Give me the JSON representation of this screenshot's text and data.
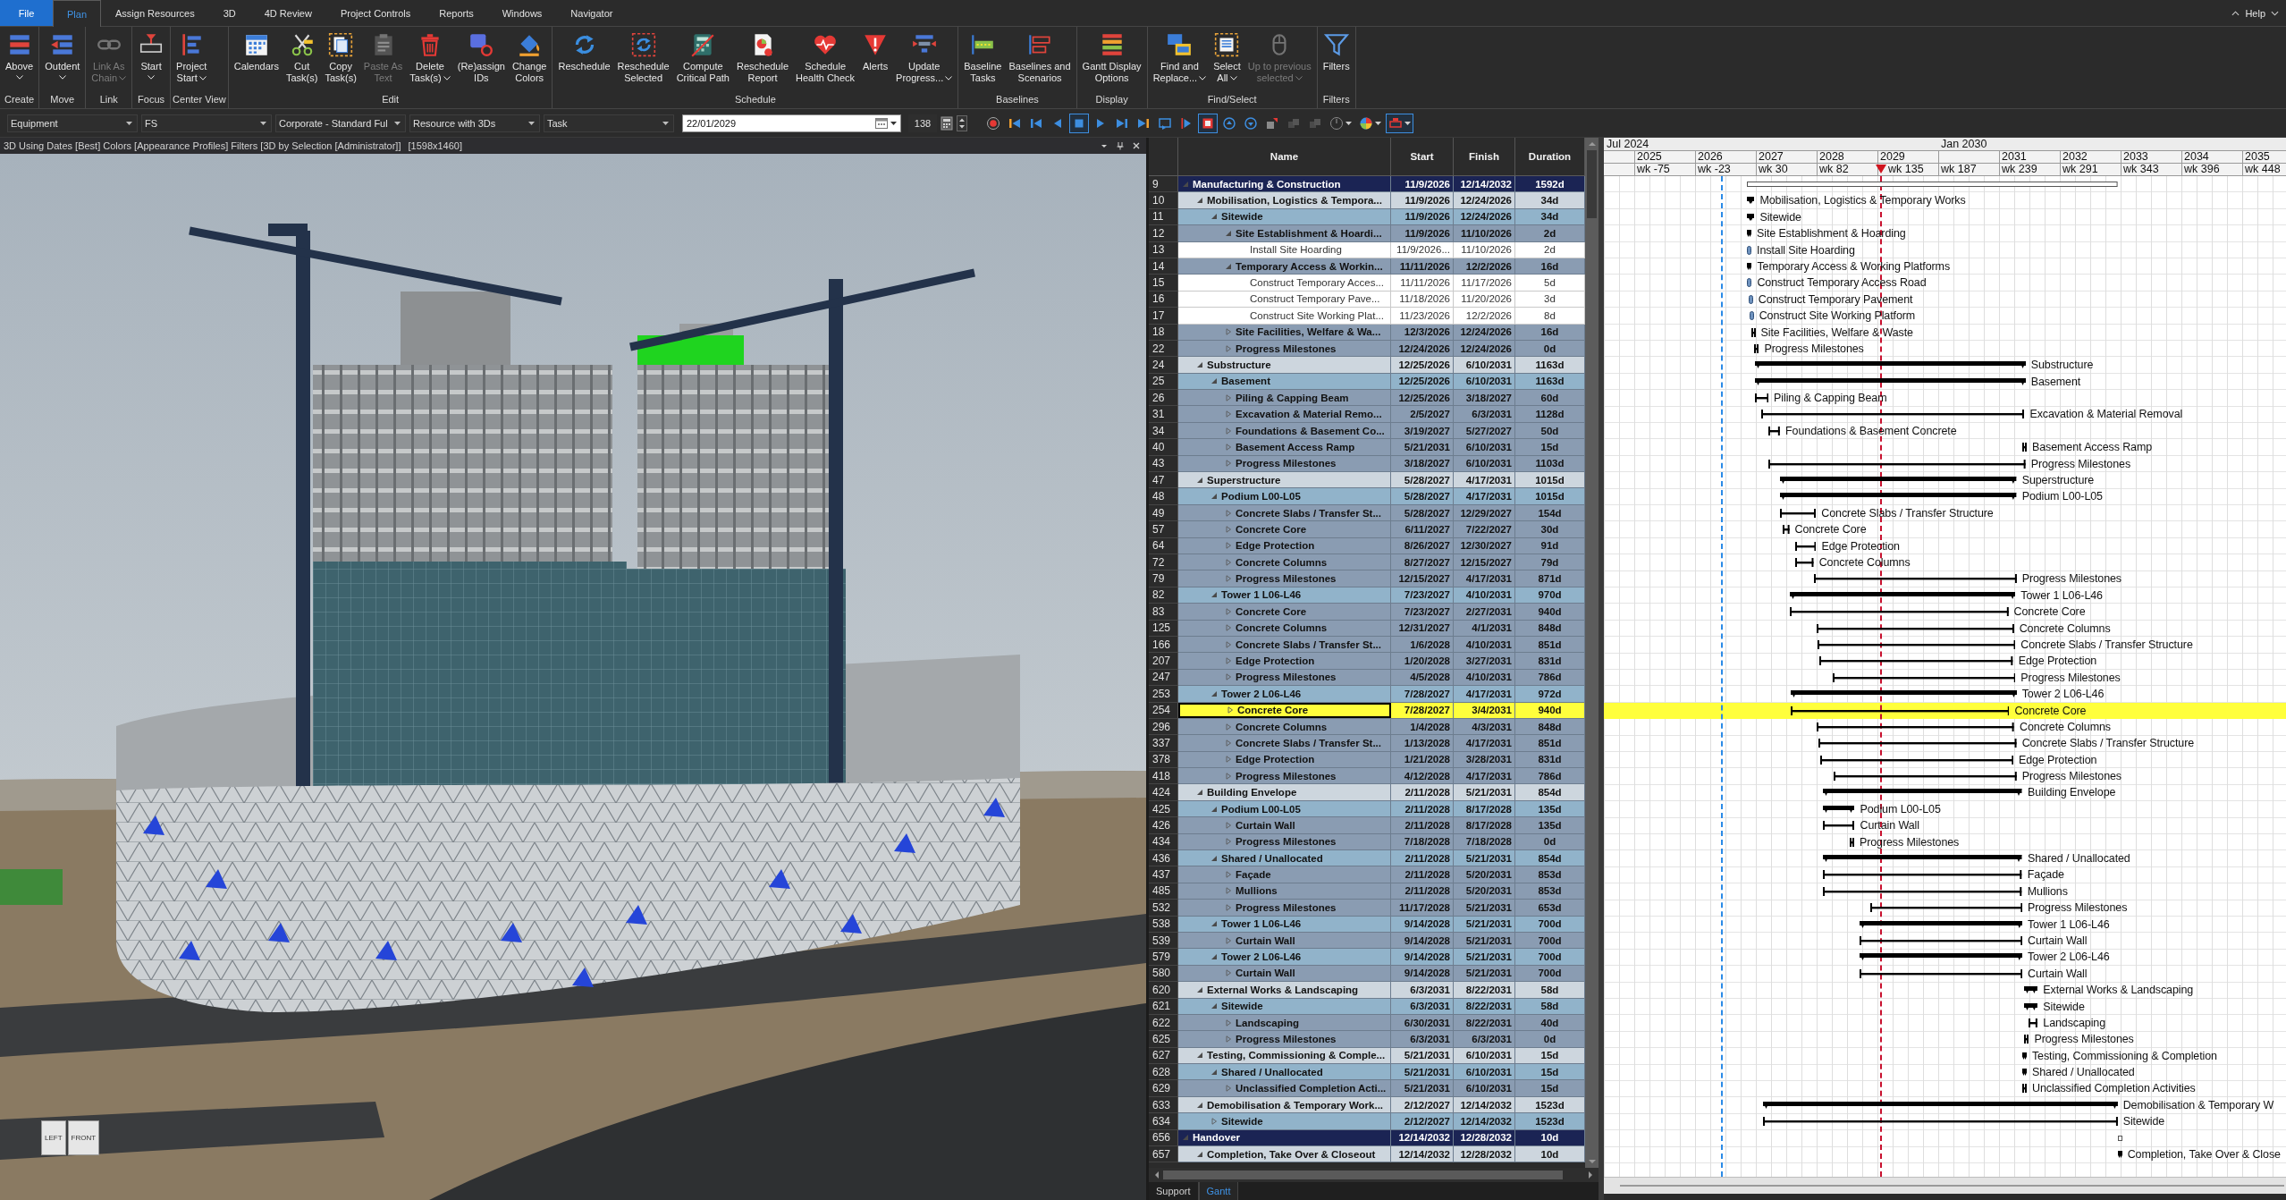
{
  "menu": {
    "tabs": [
      {
        "label": "File",
        "kind": "file",
        "selected": false
      },
      {
        "label": "Plan",
        "kind": "tab",
        "selected": true
      },
      {
        "label": "Assign Resources",
        "kind": "tab",
        "selected": false
      },
      {
        "label": "3D",
        "kind": "tab",
        "selected": false
      },
      {
        "label": "4D Review",
        "kind": "tab",
        "selected": false
      },
      {
        "label": "Project Controls",
        "kind": "tab",
        "selected": false
      },
      {
        "label": "Reports",
        "kind": "tab",
        "selected": false
      },
      {
        "label": "Windows",
        "kind": "tab",
        "selected": false
      },
      {
        "label": "Navigator",
        "kind": "tab",
        "selected": false
      }
    ],
    "help": "Help"
  },
  "ribbon": {
    "groups": [
      {
        "label": "Create",
        "buttons": [
          {
            "kind": "above",
            "lines": [
              "Above"
            ],
            "dropdown": true,
            "disabled": false
          }
        ]
      },
      {
        "label": "Move",
        "buttons": [
          {
            "kind": "outdent",
            "lines": [
              "Outdent"
            ],
            "dropdown": true,
            "disabled": false
          }
        ]
      },
      {
        "label": "Link",
        "buttons": [
          {
            "kind": "chain",
            "lines": [
              "Link As",
              "Chain"
            ],
            "dropdown": true,
            "disabled": true
          }
        ]
      },
      {
        "label": "Focus",
        "buttons": [
          {
            "kind": "start",
            "lines": [
              "Start"
            ],
            "dropdown": true,
            "disabled": false
          }
        ]
      },
      {
        "label": "Center View",
        "buttons": [
          {
            "kind": "project",
            "lines": [
              "Project",
              "Start"
            ],
            "dropdown": true,
            "disabled": false
          }
        ]
      },
      {
        "label": "Edit",
        "buttons": [
          {
            "kind": "calendars",
            "lines": [
              "Calendars"
            ],
            "dropdown": false,
            "disabled": false
          },
          {
            "kind": "cut",
            "lines": [
              "Cut",
              "Task(s)"
            ],
            "dropdown": false,
            "disabled": false
          },
          {
            "kind": "copy",
            "lines": [
              "Copy",
              "Task(s)"
            ],
            "dropdown": false,
            "disabled": false
          },
          {
            "kind": "paste",
            "lines": [
              "Paste As",
              "Text"
            ],
            "dropdown": false,
            "disabled": true
          },
          {
            "kind": "delete",
            "lines": [
              "Delete",
              "Task(s)"
            ],
            "dropdown": true,
            "disabled": false
          },
          {
            "kind": "ids",
            "lines": [
              "(Re)assign",
              "IDs"
            ],
            "dropdown": false,
            "disabled": false
          },
          {
            "kind": "colors",
            "lines": [
              "Change",
              "Colors"
            ],
            "dropdown": false,
            "disabled": false
          }
        ]
      },
      {
        "label": "Schedule",
        "buttons": [
          {
            "kind": "reschedule",
            "lines": [
              "Reschedule"
            ],
            "dropdown": false,
            "disabled": false
          },
          {
            "kind": "selected",
            "lines": [
              "Reschedule",
              "Selected"
            ],
            "dropdown": false,
            "disabled": false
          },
          {
            "kind": "critical",
            "lines": [
              "Compute",
              "Critical Path"
            ],
            "dropdown": false,
            "disabled": false
          },
          {
            "kind": "report",
            "lines": [
              "Reschedule",
              "Report"
            ],
            "dropdown": false,
            "disabled": false
          },
          {
            "kind": "health",
            "lines": [
              "Schedule",
              "Health Check"
            ],
            "dropdown": false,
            "disabled": false
          },
          {
            "kind": "alerts",
            "lines": [
              "Alerts"
            ],
            "dropdown": false,
            "disabled": false
          },
          {
            "kind": "progress",
            "lines": [
              "Update",
              "Progress..."
            ],
            "dropdown": true,
            "disabled": false
          }
        ]
      },
      {
        "label": "Baselines",
        "buttons": [
          {
            "kind": "baseline",
            "lines": [
              "Baseline",
              "Tasks"
            ],
            "dropdown": false,
            "disabled": false
          },
          {
            "kind": "scenarios",
            "lines": [
              "Baselines and",
              "Scenarios"
            ],
            "dropdown": false,
            "disabled": false
          }
        ]
      },
      {
        "label": "Display",
        "buttons": [
          {
            "kind": "gantt",
            "lines": [
              "Gantt Display",
              "Options"
            ],
            "dropdown": false,
            "disabled": false
          }
        ]
      },
      {
        "label": "Find/Select",
        "buttons": [
          {
            "kind": "find",
            "lines": [
              "Find and",
              "Replace..."
            ],
            "dropdown": true,
            "disabled": false
          },
          {
            "kind": "select",
            "lines": [
              "Select",
              "All"
            ],
            "dropdown": true,
            "disabled": false
          },
          {
            "kind": "previous",
            "lines": [
              "Up to previous",
              "selected"
            ],
            "dropdown": true,
            "disabled": true
          }
        ]
      },
      {
        "label": "Filters",
        "buttons": [
          {
            "kind": "filters",
            "lines": [
              "Filters"
            ],
            "dropdown": false,
            "disabled": false
          }
        ]
      }
    ]
  },
  "toolbar": {
    "dropdowns": [
      "Equipment",
      "FS",
      "Corporate - Standard Ful",
      "Resource with 3Ds",
      "Task"
    ],
    "date": "22/01/2029",
    "frame": "138",
    "tools": [
      {
        "kind": "record",
        "selected": false,
        "disabled": false,
        "dropdown": false
      },
      {
        "kind": "first",
        "selected": false,
        "disabled": false,
        "dropdown": false
      },
      {
        "kind": "previous",
        "selected": false,
        "disabled": false,
        "dropdown": false
      },
      {
        "kind": "back",
        "selected": false,
        "disabled": false,
        "dropdown": false
      },
      {
        "kind": "stop",
        "selected": true,
        "disabled": false,
        "dropdown": false
      },
      {
        "kind": "play",
        "selected": false,
        "disabled": false,
        "dropdown": false
      },
      {
        "kind": "next",
        "selected": false,
        "disabled": false,
        "dropdown": false
      },
      {
        "kind": "last",
        "selected": false,
        "disabled": false,
        "dropdown": false
      },
      {
        "kind": "loop",
        "selected": false,
        "disabled": false,
        "dropdown": false
      },
      {
        "kind": "flag",
        "selected": false,
        "disabled": false,
        "dropdown": false
      },
      {
        "kind": "frame",
        "selected": true,
        "disabled": false,
        "dropdown": false
      },
      {
        "kind": "up",
        "selected": false,
        "disabled": false,
        "dropdown": false
      },
      {
        "kind": "down",
        "selected": false,
        "disabled": false,
        "dropdown": false
      },
      {
        "kind": "move",
        "selected": false,
        "disabled": false,
        "dropdown": false
      },
      {
        "kind": "squares",
        "selected": false,
        "disabled": true,
        "dropdown": false
      },
      {
        "kind": "squares",
        "selected": false,
        "disabled": true,
        "dropdown": false
      },
      {
        "kind": "dial",
        "selected": false,
        "disabled": false,
        "dropdown": true
      },
      {
        "kind": "palette",
        "selected": false,
        "disabled": false,
        "dropdown": true
      },
      {
        "kind": "marker",
        "selected": true,
        "disabled": false,
        "dropdown": true
      }
    ]
  },
  "view_panel": {
    "title": "3D Using Dates [Best] Colors [Appearance Profiles] Filters [3D by Selection [Administrator]]",
    "size": "[1598x1460]",
    "cube_faces": [
      "LEFT",
      "FRONT"
    ]
  },
  "schedule": {
    "columns": [
      "Name",
      "Start",
      "Finish",
      "Duration"
    ],
    "rows": [
      {
        "id": "9",
        "name": "Manufacturing & Construction",
        "start": "11/9/2026",
        "finish": "12/14/2032",
        "duration": "1592d",
        "kind": "summary",
        "expanded": true,
        "selected": false,
        "children": [
          {
            "id": "10",
            "name": "Mobilisation, Logistics & Tempora...",
            "start": "11/9/2026",
            "finish": "12/24/2026",
            "duration": "34d",
            "kind": "summary",
            "expanded": true,
            "selected": false,
            "gantt_label": "Mobilisation, Logistics & Temporary Works",
            "children": [
              {
                "id": "11",
                "name": "Sitewide",
                "start": "11/9/2026",
                "finish": "12/24/2026",
                "duration": "34d",
                "kind": "summary",
                "expanded": true,
                "selected": false,
                "gantt_label": "Sitewide",
                "children": [
                  {
                    "id": "12",
                    "name": "Site Establishment & Hoardi...",
                    "start": "11/9/2026",
                    "finish": "11/10/2026",
                    "duration": "2d",
                    "kind": "summary",
                    "expanded": true,
                    "selected": false,
                    "gantt_label": "Site Establishment & Hoarding",
                    "children": [
                      {
                        "id": "13",
                        "name": "Install Site Hoarding",
                        "start": "11/9/2026...",
                        "finish": "11/10/2026",
                        "duration": "2d",
                        "kind": "task",
                        "selected": false,
                        "gantt_label": "Install Site Hoarding"
                      }
                    ]
                  },
                  {
                    "id": "14",
                    "name": "Temporary Access & Workin...",
                    "start": "11/11/2026",
                    "finish": "12/2/2026",
                    "duration": "16d",
                    "kind": "summary",
                    "expanded": true,
                    "selected": false,
                    "gantt_label": "Temporary Access & Working Platforms",
                    "children": [
                      {
                        "id": "15",
                        "name": "Construct Temporary Acces...",
                        "start": "11/11/2026",
                        "finish": "11/17/2026",
                        "duration": "5d",
                        "kind": "task",
                        "selected": false,
                        "gantt_label": "Construct Temporary Access Road"
                      },
                      {
                        "id": "16",
                        "name": "Construct Temporary Pave...",
                        "start": "11/18/2026",
                        "finish": "11/20/2026",
                        "duration": "3d",
                        "kind": "task",
                        "selected": false,
                        "gantt_label": "Construct Temporary Pavement"
                      },
                      {
                        "id": "17",
                        "name": "Construct Site Working Plat...",
                        "start": "11/23/2026",
                        "finish": "12/2/2026",
                        "duration": "8d",
                        "kind": "task",
                        "selected": false,
                        "gantt_label": "Construct Site Working Platform"
                      }
                    ]
                  },
                  {
                    "id": "18",
                    "name": "Site Facilities, Welfare & Wa...",
                    "start": "12/3/2026",
                    "finish": "12/24/2026",
                    "duration": "16d",
                    "kind": "summary",
                    "expanded": false,
                    "selected": false,
                    "gantt_label": "Site Facilities, Welfare & Waste"
                  },
                  {
                    "id": "22",
                    "name": "Progress Milestones",
                    "start": "12/24/2026",
                    "finish": "12/24/2026",
                    "duration": "0d",
                    "kind": "summary",
                    "expanded": false,
                    "selected": false,
                    "gantt_label": "Progress Milestones"
                  }
                ]
              }
            ]
          },
          {
            "id": "24",
            "name": "Substructure",
            "start": "12/25/2026",
            "finish": "6/10/2031",
            "duration": "1163d",
            "kind": "summary",
            "expanded": true,
            "selected": false,
            "gantt_label": "Substructure",
            "children": [
              {
                "id": "25",
                "name": "Basement",
                "start": "12/25/2026",
                "finish": "6/10/2031",
                "duration": "1163d",
                "kind": "summary",
                "expanded": true,
                "selected": false,
                "gantt_label": "Basement",
                "children": [
                  {
                    "id": "26",
                    "name": "Piling & Capping Beam",
                    "start": "12/25/2026",
                    "finish": "3/18/2027",
                    "duration": "60d",
                    "kind": "summary",
                    "expanded": false,
                    "selected": false,
                    "gantt_label": "Piling & Capping Beam"
                  },
                  {
                    "id": "31",
                    "name": "Excavation & Material Remo...",
                    "start": "2/5/2027",
                    "finish": "6/3/2031",
                    "duration": "1128d",
                    "kind": "summary",
                    "expanded": false,
                    "selected": false,
                    "gantt_label": "Excavation & Material Removal"
                  },
                  {
                    "id": "34",
                    "name": "Foundations & Basement Co...",
                    "start": "3/19/2027",
                    "finish": "5/27/2027",
                    "duration": "50d",
                    "kind": "summary",
                    "expanded": false,
                    "selected": false,
                    "gantt_label": "Foundations & Basement Concrete"
                  },
                  {
                    "id": "40",
                    "name": "Basement Access Ramp",
                    "start": "5/21/2031",
                    "finish": "6/10/2031",
                    "duration": "15d",
                    "kind": "summary",
                    "expanded": false,
                    "selected": false,
                    "gantt_label": "Basement Access Ramp"
                  },
                  {
                    "id": "43",
                    "name": "Progress Milestones",
                    "start": "3/18/2027",
                    "finish": "6/10/2031",
                    "duration": "1103d",
                    "kind": "summary",
                    "expanded": false,
                    "selected": false,
                    "gantt_label": "Progress Milestones"
                  }
                ]
              }
            ]
          },
          {
            "id": "47",
            "name": "Superstructure",
            "start": "5/28/2027",
            "finish": "4/17/2031",
            "duration": "1015d",
            "kind": "summary",
            "expanded": true,
            "selected": false,
            "gantt_label": "Superstructure",
            "children": [
              {
                "id": "48",
                "name": "Podium L00-L05",
                "start": "5/28/2027",
                "finish": "4/17/2031",
                "duration": "1015d",
                "kind": "summary",
                "expanded": true,
                "selected": false,
                "gantt_label": "Podium L00-L05",
                "children": [
                  {
                    "id": "49",
                    "name": "Concrete Slabs / Transfer St...",
                    "start": "5/28/2027",
                    "finish": "12/29/2027",
                    "duration": "154d",
                    "kind": "summary",
                    "expanded": false,
                    "selected": false,
                    "gantt_label": "Concrete Slabs / Transfer Structure"
                  },
                  {
                    "id": "57",
                    "name": "Concrete Core",
                    "start": "6/11/2027",
                    "finish": "7/22/2027",
                    "duration": "30d",
                    "kind": "summary",
                    "expanded": false,
                    "selected": false,
                    "gantt_label": "Concrete Core"
                  },
                  {
                    "id": "64",
                    "name": "Edge Protection",
                    "start": "8/26/2027",
                    "finish": "12/30/2027",
                    "duration": "91d",
                    "kind": "summary",
                    "expanded": false,
                    "selected": false,
                    "gantt_label": "Edge Protection"
                  },
                  {
                    "id": "72",
                    "name": "Concrete Columns",
                    "start": "8/27/2027",
                    "finish": "12/15/2027",
                    "duration": "79d",
                    "kind": "summary",
                    "expanded": false,
                    "selected": false,
                    "gantt_label": "Concrete Columns"
                  },
                  {
                    "id": "79",
                    "name": "Progress Milestones",
                    "start": "12/15/2027",
                    "finish": "4/17/2031",
                    "duration": "871d",
                    "kind": "summary",
                    "expanded": false,
                    "selected": false,
                    "gantt_label": "Progress Milestones"
                  }
                ]
              },
              {
                "id": "82",
                "name": "Tower 1 L06-L46",
                "start": "7/23/2027",
                "finish": "4/10/2031",
                "duration": "970d",
                "kind": "summary",
                "expanded": true,
                "selected": false,
                "gantt_label": "Tower 1 L06-L46",
                "children": [
                  {
                    "id": "83",
                    "name": "Concrete Core",
                    "start": "7/23/2027",
                    "finish": "2/27/2031",
                    "duration": "940d",
                    "kind": "summary",
                    "expanded": false,
                    "selected": false,
                    "gantt_label": "Concrete Core"
                  },
                  {
                    "id": "125",
                    "name": "Concrete Columns",
                    "start": "12/31/2027",
                    "finish": "4/1/2031",
                    "duration": "848d",
                    "kind": "summary",
                    "expanded": false,
                    "selected": false,
                    "gantt_label": "Concrete Columns"
                  },
                  {
                    "id": "166",
                    "name": "Concrete Slabs / Transfer St...",
                    "start": "1/6/2028",
                    "finish": "4/10/2031",
                    "duration": "851d",
                    "kind": "summary",
                    "expanded": false,
                    "selected": false,
                    "gantt_label": "Concrete Slabs / Transfer Structure"
                  },
                  {
                    "id": "207",
                    "name": "Edge Protection",
                    "start": "1/20/2028",
                    "finish": "3/27/2031",
                    "duration": "831d",
                    "kind": "summary",
                    "expanded": false,
                    "selected": false,
                    "gantt_label": "Edge Protection"
                  },
                  {
                    "id": "247",
                    "name": "Progress Milestones",
                    "start": "4/5/2028",
                    "finish": "4/10/2031",
                    "duration": "786d",
                    "kind": "summary",
                    "expanded": false,
                    "selected": false,
                    "gantt_label": "Progress Milestones"
                  }
                ]
              },
              {
                "id": "253",
                "name": "Tower 2 L06-L46",
                "start": "7/28/2027",
                "finish": "4/17/2031",
                "duration": "972d",
                "kind": "summary",
                "expanded": true,
                "selected": false,
                "gantt_label": "Tower 2 L06-L46",
                "children": [
                  {
                    "id": "254",
                    "name": "Concrete Core",
                    "start": "7/28/2027",
                    "finish": "3/4/2031",
                    "duration": "940d",
                    "kind": "summary",
                    "expanded": false,
                    "selected": true,
                    "gantt_label": "Concrete Core"
                  },
                  {
                    "id": "296",
                    "name": "Concrete Columns",
                    "start": "1/4/2028",
                    "finish": "4/3/2031",
                    "duration": "848d",
                    "kind": "summary",
                    "expanded": false,
                    "selected": false,
                    "gantt_label": "Concrete Columns"
                  },
                  {
                    "id": "337",
                    "name": "Concrete Slabs / Transfer St...",
                    "start": "1/13/2028",
                    "finish": "4/17/2031",
                    "duration": "851d",
                    "kind": "summary",
                    "expanded": false,
                    "selected": false,
                    "gantt_label": "Concrete Slabs / Transfer Structure"
                  },
                  {
                    "id": "378",
                    "name": "Edge Protection",
                    "start": "1/21/2028",
                    "finish": "3/28/2031",
                    "duration": "831d",
                    "kind": "summary",
                    "expanded": false,
                    "selected": false,
                    "gantt_label": "Edge Protection"
                  },
                  {
                    "id": "418",
                    "name": "Progress Milestones",
                    "start": "4/12/2028",
                    "finish": "4/17/2031",
                    "duration": "786d",
                    "kind": "summary",
                    "expanded": false,
                    "selected": false,
                    "gantt_label": "Progress Milestones"
                  }
                ]
              }
            ]
          },
          {
            "id": "424",
            "name": "Building Envelope",
            "start": "2/11/2028",
            "finish": "5/21/2031",
            "duration": "854d",
            "kind": "summary",
            "expanded": true,
            "selected": false,
            "gantt_label": "Building Envelope",
            "children": [
              {
                "id": "425",
                "name": "Podium L00-L05",
                "start": "2/11/2028",
                "finish": "8/17/2028",
                "duration": "135d",
                "kind": "summary",
                "expanded": true,
                "selected": false,
                "gantt_label": "Podium L00-L05",
                "children": [
                  {
                    "id": "426",
                    "name": "Curtain Wall",
                    "start": "2/11/2028",
                    "finish": "8/17/2028",
                    "duration": "135d",
                    "kind": "summary",
                    "expanded": false,
                    "selected": false,
                    "gantt_label": "Curtain Wall"
                  },
                  {
                    "id": "434",
                    "name": "Progress Milestones",
                    "start": "7/18/2028",
                    "finish": "7/18/2028",
                    "duration": "0d",
                    "kind": "summary",
                    "expanded": false,
                    "selected": false,
                    "gantt_label": "Progress Milestones"
                  }
                ]
              },
              {
                "id": "436",
                "name": "Shared / Unallocated",
                "start": "2/11/2028",
                "finish": "5/21/2031",
                "duration": "854d",
                "kind": "summary",
                "expanded": true,
                "selected": false,
                "gantt_label": "Shared / Unallocated",
                "children": [
                  {
                    "id": "437",
                    "name": "Façade",
                    "start": "2/11/2028",
                    "finish": "5/20/2031",
                    "duration": "853d",
                    "kind": "summary",
                    "expanded": false,
                    "selected": false,
                    "gantt_label": "Façade"
                  },
                  {
                    "id": "485",
                    "name": "Mullions",
                    "start": "2/11/2028",
                    "finish": "5/20/2031",
                    "duration": "853d",
                    "kind": "summary",
                    "expanded": false,
                    "selected": false,
                    "gantt_label": "Mullions"
                  },
                  {
                    "id": "532",
                    "name": "Progress Milestones",
                    "start": "11/17/2028",
                    "finish": "5/21/2031",
                    "duration": "653d",
                    "kind": "summary",
                    "expanded": false,
                    "selected": false,
                    "gantt_label": "Progress Milestones"
                  }
                ]
              },
              {
                "id": "538",
                "name": "Tower 1 L06-L46",
                "start": "9/14/2028",
                "finish": "5/21/2031",
                "duration": "700d",
                "kind": "summary",
                "expanded": true,
                "selected": false,
                "gantt_label": "Tower 1 L06-L46",
                "children": [
                  {
                    "id": "539",
                    "name": "Curtain Wall",
                    "start": "9/14/2028",
                    "finish": "5/21/2031",
                    "duration": "700d",
                    "kind": "summary",
                    "expanded": false,
                    "selected": false,
                    "gantt_label": "Curtain Wall"
                  }
                ]
              },
              {
                "id": "579",
                "name": "Tower 2 L06-L46",
                "start": "9/14/2028",
                "finish": "5/21/2031",
                "duration": "700d",
                "kind": "summary",
                "expanded": true,
                "selected": false,
                "gantt_label": "Tower 2 L06-L46",
                "children": [
                  {
                    "id": "580",
                    "name": "Curtain Wall",
                    "start": "9/14/2028",
                    "finish": "5/21/2031",
                    "duration": "700d",
                    "kind": "summary",
                    "expanded": false,
                    "selected": false,
                    "gantt_label": "Curtain Wall"
                  }
                ]
              }
            ]
          },
          {
            "id": "620",
            "name": "External Works & Landscaping",
            "start": "6/3/2031",
            "finish": "8/22/2031",
            "duration": "58d",
            "kind": "summary",
            "expanded": true,
            "selected": false,
            "gantt_label": "External Works & Landscaping",
            "children": [
              {
                "id": "621",
                "name": "Sitewide",
                "start": "6/3/2031",
                "finish": "8/22/2031",
                "duration": "58d",
                "kind": "summary",
                "expanded": true,
                "selected": false,
                "gantt_label": "Sitewide",
                "children": [
                  {
                    "id": "622",
                    "name": "Landscaping",
                    "start": "6/30/2031",
                    "finish": "8/22/2031",
                    "duration": "40d",
                    "kind": "summary",
                    "expanded": false,
                    "selected": false,
                    "gantt_label": "Landscaping"
                  },
                  {
                    "id": "625",
                    "name": "Progress Milestones",
                    "start": "6/3/2031",
                    "finish": "6/3/2031",
                    "duration": "0d",
                    "kind": "summary",
                    "expanded": false,
                    "selected": false,
                    "gantt_label": "Progress Milestones"
                  }
                ]
              }
            ]
          },
          {
            "id": "627",
            "name": "Testing, Commissioning & Comple...",
            "start": "5/21/2031",
            "finish": "6/10/2031",
            "duration": "15d",
            "kind": "summary",
            "expanded": true,
            "selected": false,
            "gantt_label": "Testing, Commissioning & Completion",
            "children": [
              {
                "id": "628",
                "name": "Shared / Unallocated",
                "start": "5/21/2031",
                "finish": "6/10/2031",
                "duration": "15d",
                "kind": "summary",
                "expanded": true,
                "selected": false,
                "gantt_label": "Shared / Unallocated",
                "children": [
                  {
                    "id": "629",
                    "name": "Unclassified Completion Acti...",
                    "start": "5/21/2031",
                    "finish": "6/10/2031",
                    "duration": "15d",
                    "kind": "summary",
                    "expanded": false,
                    "selected": false,
                    "gantt_label": "Unclassified Completion Activities"
                  }
                ]
              }
            ]
          },
          {
            "id": "633",
            "name": "Demobilisation & Temporary Work...",
            "start": "2/12/2027",
            "finish": "12/14/2032",
            "duration": "1523d",
            "kind": "summary",
            "expanded": true,
            "selected": false,
            "gantt_label": "Demobilisation & Temporary W",
            "children": [
              {
                "id": "634",
                "name": "Sitewide",
                "start": "2/12/2027",
                "finish": "12/14/2032",
                "duration": "1523d",
                "kind": "summary",
                "expanded": false,
                "selected": false,
                "gantt_label": "Sitewide"
              }
            ]
          }
        ]
      },
      {
        "id": "656",
        "name": "Handover",
        "start": "12/14/2032",
        "finish": "12/28/2032",
        "duration": "10d",
        "kind": "summary",
        "expanded": true,
        "selected": false,
        "children": [
          {
            "id": "657",
            "name": "Completion, Take Over & Closeout",
            "start": "12/14/2032",
            "finish": "12/28/2032",
            "duration": "10d",
            "kind": "summary",
            "expanded": true,
            "selected": false,
            "gantt_label": "Completion, Take Over & Close"
          }
        ]
      }
    ]
  },
  "gantt": {
    "periods": [
      "Jul 2024",
      "Jan 2030"
    ],
    "columns": [
      {
        "year": "2025",
        "week": "wk -75"
      },
      {
        "year": "2026",
        "week": "wk -23"
      },
      {
        "year": "2027",
        "week": "wk 30"
      },
      {
        "year": "2028",
        "week": "wk 82"
      },
      {
        "year": "2029",
        "week": "wk 135"
      },
      {
        "week": "wk 187"
      },
      {
        "year": "2031",
        "week": "wk 239"
      },
      {
        "year": "2032",
        "week": "wk 291"
      },
      {
        "year": "2033",
        "week": "wk 343"
      },
      {
        "year": "2034",
        "week": "wk 396"
      },
      {
        "year": "2035",
        "week": "wk 448"
      }
    ]
  },
  "bottom_tabs": [
    {
      "label": "Support",
      "selected": false
    },
    {
      "label": "Gantt",
      "selected": true
    }
  ]
}
